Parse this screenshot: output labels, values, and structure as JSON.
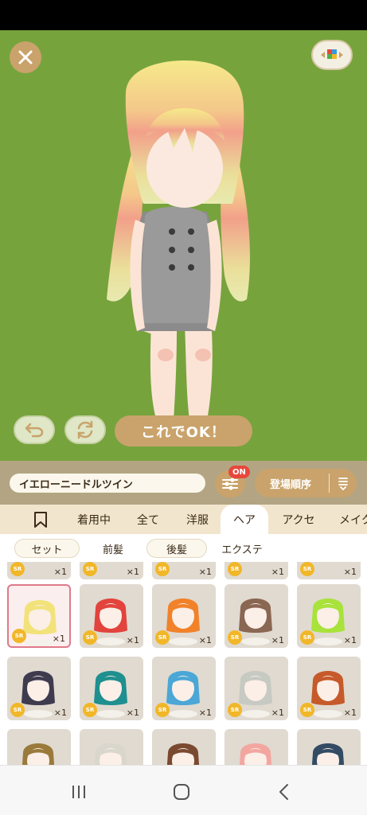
{
  "colors": {
    "stage_background": "#77a33d",
    "accent_gold": "#c9a36b",
    "badge_red": "#e8473b",
    "rarity_yellow": "#f1b729",
    "selected_border": "#e07a8a"
  },
  "stage": {
    "close_icon": "close-icon",
    "layout_icon": "color-palette-icon",
    "undo_icon": "undo-icon",
    "reset_icon": "refresh-icon",
    "confirm_label": "これでOK！"
  },
  "controls": {
    "item_name": "イエローニードルツイン",
    "filter_icon": "sliders-icon",
    "filter_badge": "ON",
    "sort_label": "登場順序",
    "sort_icon": "sort-order-icon"
  },
  "tabs": [
    {
      "label": "",
      "icon": "bookmark-icon"
    },
    {
      "label": "着用中"
    },
    {
      "label": "全て"
    },
    {
      "label": "洋服"
    },
    {
      "label": "ヘア",
      "active": true
    },
    {
      "label": "アクセ"
    },
    {
      "label": "メイク"
    }
  ],
  "subtabs": [
    {
      "label": "セット"
    },
    {
      "label": "前髪"
    },
    {
      "label": "後髪"
    },
    {
      "label": "エクステ"
    }
  ],
  "items": [
    {
      "rarity": "SR",
      "qty": "×1",
      "hair": "#9e9e9e"
    },
    {
      "rarity": "SR",
      "qty": "×1",
      "hair": "#b0b0b0"
    },
    {
      "rarity": "SR",
      "qty": "×1",
      "hair": "#c9c9c9"
    },
    {
      "rarity": "SR",
      "qty": "×1",
      "hair": "#bdbdbd"
    },
    {
      "rarity": "SR",
      "qty": "×1",
      "hair": "#8f8f8f"
    },
    {
      "rarity": "SR",
      "qty": "×1",
      "hair": "#f2e27a",
      "selected": true
    },
    {
      "rarity": "SR",
      "qty": "×1",
      "hair": "#e2433d"
    },
    {
      "rarity": "SR",
      "qty": "×1",
      "hair": "#f1822a"
    },
    {
      "rarity": "SR",
      "qty": "×1",
      "hair": "#8a6752"
    },
    {
      "rarity": "SR",
      "qty": "×1",
      "hair": "#a8e23b"
    },
    {
      "rarity": "SR",
      "qty": "×1",
      "hair": "#3f3b4f"
    },
    {
      "rarity": "SR",
      "qty": "×1",
      "hair": "#1f8f8f"
    },
    {
      "rarity": "SR",
      "qty": "×1",
      "hair": "#4aa7d6"
    },
    {
      "rarity": "SR",
      "qty": "×1",
      "hair": "#c7c9c3"
    },
    {
      "rarity": "SR",
      "qty": "×1",
      "hair": "#c65a2b"
    },
    {
      "rarity": "",
      "qty": "",
      "hair": "#9a7a3a"
    },
    {
      "rarity": "",
      "qty": "",
      "hair": "#d9d6cd"
    },
    {
      "rarity": "",
      "qty": "",
      "hair": "#7a4a30"
    },
    {
      "rarity": "",
      "qty": "",
      "hair": "#f3a6a0"
    },
    {
      "rarity": "",
      "qty": "",
      "hair": "#334b63"
    }
  ],
  "nav": {
    "recents_icon": "recent-apps-icon",
    "home_icon": "home-icon",
    "back_icon": "back-icon"
  }
}
